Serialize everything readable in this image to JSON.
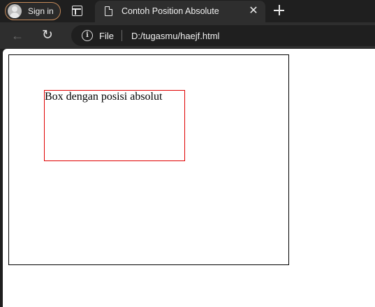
{
  "browser": {
    "sign_in_label": "Sign in",
    "tab_title": "Contoh Position Absolute",
    "tab_close_glyph": "✕",
    "new_tab_icon": "plus-icon",
    "back_glyph": "←",
    "reload_glyph": "↻",
    "site_info_glyph": "i",
    "address_chip": "File",
    "url": "D:/tugasmu/haejf.html"
  },
  "page": {
    "absolute_box_text": "Box dengan posisi absolut"
  },
  "colors": {
    "container_border": "#000000",
    "absolute_box_border": "#e00000",
    "sign_in_border": "#c58a5a"
  }
}
